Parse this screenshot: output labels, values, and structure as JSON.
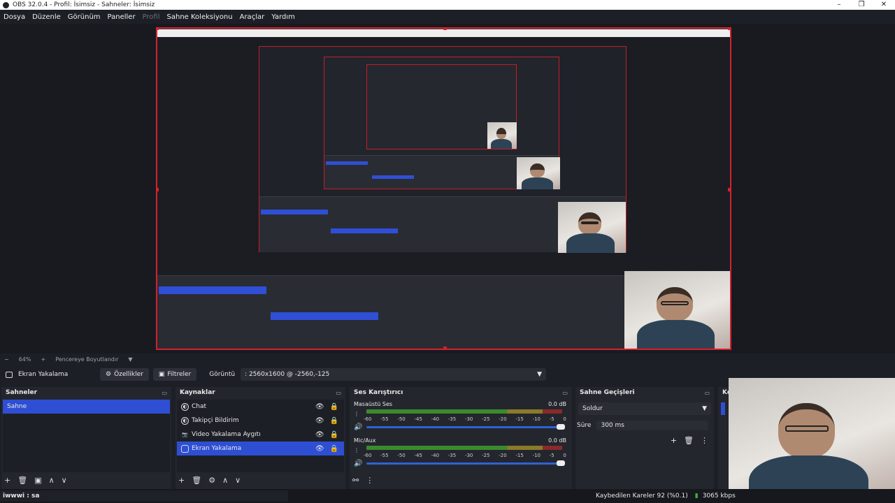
{
  "window": {
    "title": "OBS 32.0.4 - Profil: İsimsiz - Sahneler: İsimsiz"
  },
  "menu": [
    "Dosya",
    "Düzenle",
    "Görünüm",
    "Paneller",
    "Profil",
    "Sahne Koleksiyonu",
    "Araçlar",
    "Yardım"
  ],
  "zoom": {
    "level": "64%",
    "mode": "Pencereye Boyutlandır"
  },
  "propbar": {
    "source": "Ekran Yakalama",
    "properties": "Özellikler",
    "filters": "Filtreler",
    "display_label": "Görüntü",
    "display_value": ": 2560x1600 @ -2560,-125"
  },
  "scenes": {
    "title": "Sahneler",
    "items": [
      "Sahne"
    ]
  },
  "sources": {
    "title": "Kaynaklar",
    "items": [
      "Chat",
      "Takipçi Bildirim",
      "Video Yakalama Aygıtı",
      "Ekran Yakalama"
    ]
  },
  "mixer": {
    "title": "Ses Karıştırıcı",
    "channels": [
      {
        "name": "Masaüstü Ses",
        "db": "0.0 dB"
      },
      {
        "name": "Mic/Aux",
        "db": "0.0 dB"
      }
    ],
    "scale": [
      "-60",
      "-55",
      "-50",
      "-45",
      "-40",
      "-35",
      "-30",
      "-25",
      "-20",
      "-15",
      "-10",
      "-5",
      "0"
    ]
  },
  "transitions": {
    "title": "Sahne Geçişleri",
    "type": "Soldur",
    "duration_label": "Süre",
    "duration": "300 ms"
  },
  "controls": {
    "title": "Ko"
  },
  "status": {
    "stream_text": "iwwwi : sa",
    "dropped": "Kaybedilen Kareler 92 (%0.1)",
    "bitrate": "3065 kbps"
  },
  "colors": {
    "accent": "#2e4fd3",
    "selection_border": "#d8202a"
  }
}
